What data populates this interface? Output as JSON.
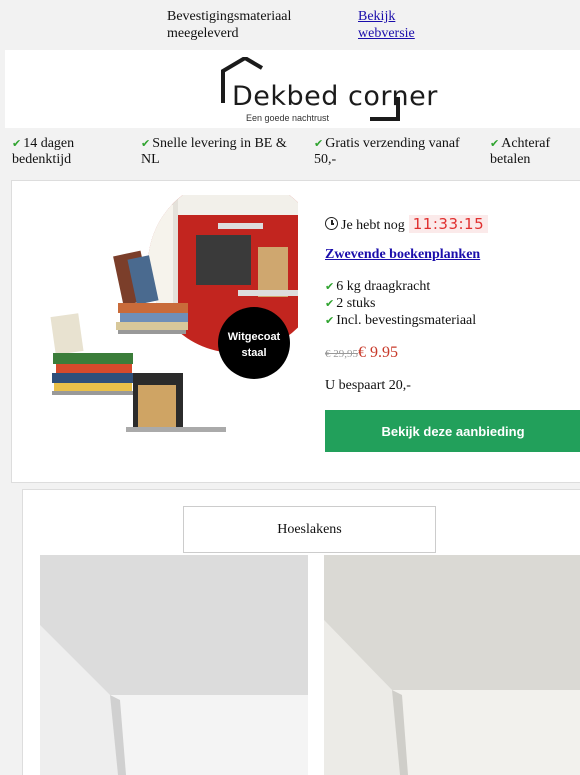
{
  "header": {
    "fastening_text": "Bevestigingsmateriaal meegeleverd",
    "web_link": "Bekijk webversie"
  },
  "logo": {
    "brand": "Dekbed corner",
    "tagline": "Een goede nachtrust"
  },
  "usps": [
    "14 dagen bedenktijd",
    "Snelle levering in BE & NL",
    "Gratis verzending vanaf 50,-",
    "Achteraf betalen"
  ],
  "offer": {
    "timer_label": "Je hebt nog",
    "timer": "11:33:15",
    "title": "Zwevende boekenplanken",
    "features": [
      "6 kg draagkracht",
      "2 stuks",
      "Incl. bevestingsmateriaal"
    ],
    "old_price": "€ 29,95",
    "new_price": "€ 9.95",
    "savings": "U bespaart 20,-",
    "cta": "Bekijk deze aanbieding",
    "badge": [
      "Witgecoat",
      "staal"
    ]
  },
  "category": {
    "button": "Hoeslakens"
  },
  "colors": {
    "accent_green": "#22a05b",
    "link_blue": "#1a0dab",
    "price_red": "#c83a2a",
    "timer_red": "#e03030"
  }
}
